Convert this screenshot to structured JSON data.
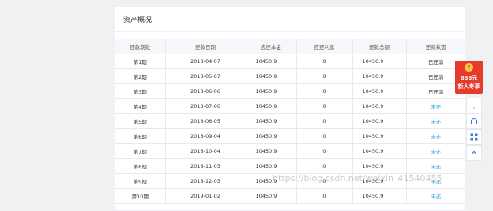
{
  "panel": {
    "title": "资产概况"
  },
  "table": {
    "headers": [
      "还款期数",
      "还款日期",
      "应还本金",
      "应还利息",
      "还款总额",
      "还款状态"
    ],
    "rows": [
      [
        "第1期",
        "2018-04-07",
        "10450.9",
        "0",
        "10450.9",
        "已还清"
      ],
      [
        "第2期",
        "2018-05-07",
        "10450.9",
        "0",
        "10450.9",
        "已还清"
      ],
      [
        "第3期",
        "2018-06-06",
        "10450.9",
        "0",
        "10450.9",
        "已还清"
      ],
      [
        "第4期",
        "2018-07-06",
        "10450.9",
        "0",
        "10450.9",
        "未还"
      ],
      [
        "第5期",
        "2018-08-05",
        "10450.9",
        "0",
        "10450.9",
        "未还"
      ],
      [
        "第6期",
        "2018-09-04",
        "10450.9",
        "0",
        "10450.9",
        "未还"
      ],
      [
        "第7期",
        "2018-10-04",
        "10450.9",
        "0",
        "10450.9",
        "未还"
      ],
      [
        "第8期",
        "2018-11-03",
        "10450.9",
        "0",
        "10450.9",
        "未还"
      ],
      [
        "第9期",
        "2018-12-03",
        "10450.9",
        "0",
        "10450.9",
        "未还"
      ],
      [
        "第10期",
        "2019-01-02",
        "10450.9",
        "0",
        "10450.9",
        "未还"
      ]
    ]
  },
  "sidebar": {
    "promo_amount": "888元",
    "promo_text": "新人专享",
    "coin_symbol": "¥",
    "icons": [
      "phone-icon",
      "headset-icon",
      "qrcode-icon",
      "chevron-up-icon"
    ]
  },
  "watermark": "https://blog.csdn.net/weixin_41540455",
  "colors": {
    "pending": "#3aa8e3",
    "promo": "#e63a2a",
    "header_bg": "#f5f7fa"
  }
}
